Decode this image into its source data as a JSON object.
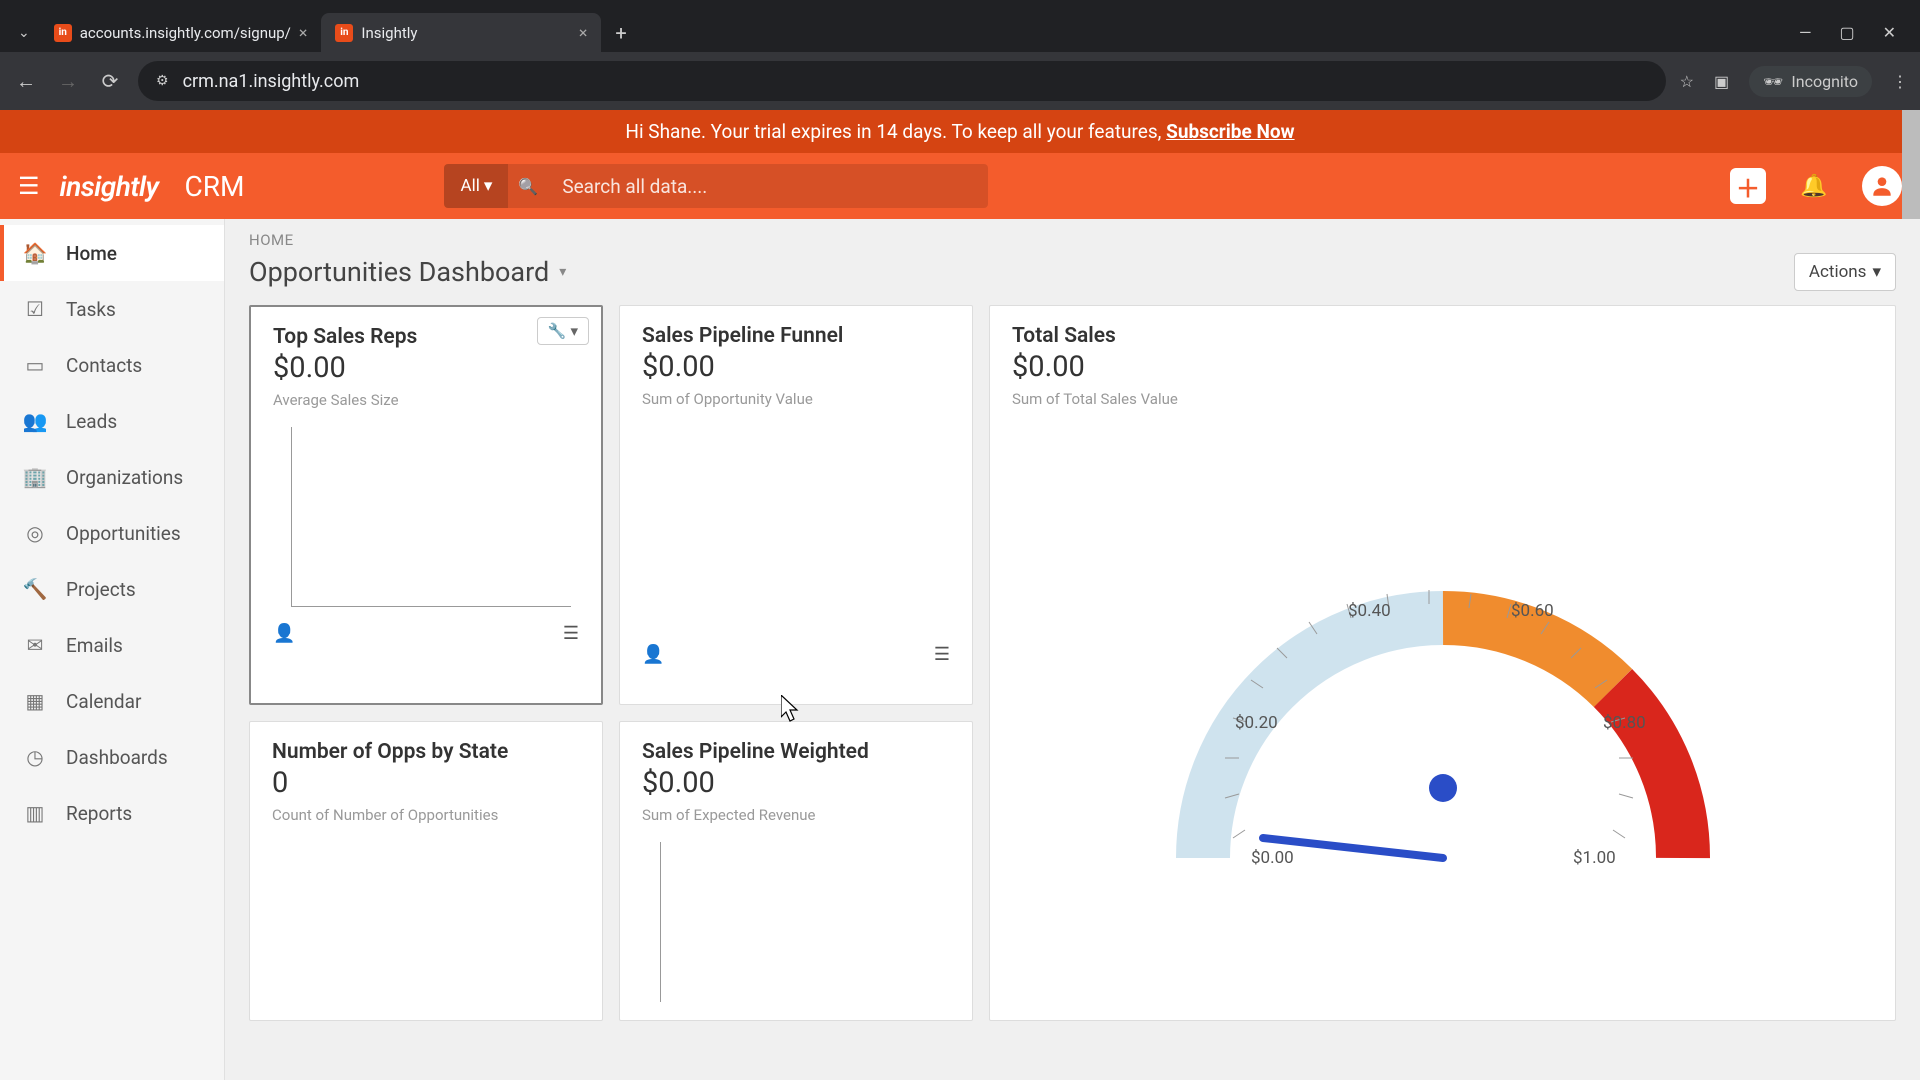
{
  "browser": {
    "tabs": [
      {
        "title": "accounts.insightly.com/signup/",
        "active": false
      },
      {
        "title": "Insightly",
        "active": true
      }
    ],
    "url": "crm.na1.insightly.com",
    "incognito_label": "Incognito"
  },
  "trial_banner": {
    "greeting": "Hi Shane. Your trial expires in 14 days. To keep all your features, ",
    "cta": "Subscribe Now"
  },
  "header": {
    "logo_text": "insightly",
    "app_name": "CRM",
    "search_filter": "All",
    "search_placeholder": "Search all data...."
  },
  "sidebar": {
    "items": [
      {
        "icon": "home",
        "label": "Home",
        "active": true
      },
      {
        "icon": "check",
        "label": "Tasks"
      },
      {
        "icon": "id",
        "label": "Contacts"
      },
      {
        "icon": "people",
        "label": "Leads"
      },
      {
        "icon": "building",
        "label": "Organizations"
      },
      {
        "icon": "target",
        "label": "Opportunities"
      },
      {
        "icon": "hammer",
        "label": "Projects"
      },
      {
        "icon": "mail",
        "label": "Emails"
      },
      {
        "icon": "calendar",
        "label": "Calendar"
      },
      {
        "icon": "gauge",
        "label": "Dashboards"
      },
      {
        "icon": "bars",
        "label": "Reports"
      }
    ]
  },
  "main": {
    "breadcrumb": "HOME",
    "title": "Opportunities Dashboard",
    "actions_label": "Actions"
  },
  "cards": {
    "top_sales_reps": {
      "title": "Top Sales Reps",
      "value": "$0.00",
      "sub": "Average Sales Size"
    },
    "pipeline_funnel": {
      "title": "Sales Pipeline Funnel",
      "value": "$0.00",
      "sub": "Sum of Opportunity Value"
    },
    "total_sales": {
      "title": "Total Sales",
      "value": "$0.00",
      "sub": "Sum of Total Sales Value"
    },
    "opps_by_state": {
      "title": "Number of Opps by State",
      "value": "0",
      "sub": "Count of Number of Opportunities"
    },
    "pipeline_weighted": {
      "title": "Sales Pipeline Weighted",
      "value": "$0.00",
      "sub": "Sum of Expected Revenue"
    }
  },
  "chart_data": {
    "type": "gauge",
    "title": "Total Sales",
    "value": 0.0,
    "min": 0.0,
    "max": 1.0,
    "ticks": [
      "$0.00",
      "$0.20",
      "$0.40",
      "$0.60",
      "$0.80",
      "$1.00"
    ],
    "bands": [
      {
        "from": 0.0,
        "to": 0.5,
        "color": "#cfe3ee"
      },
      {
        "from": 0.5,
        "to": 0.75,
        "color": "#f08c2e"
      },
      {
        "from": 0.75,
        "to": 1.0,
        "color": "#d9261c"
      }
    ]
  }
}
